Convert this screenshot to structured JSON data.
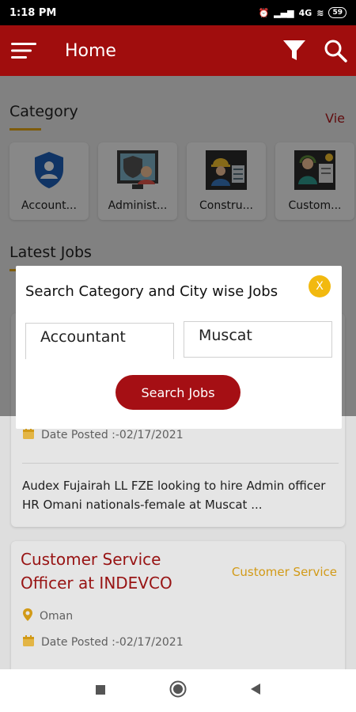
{
  "status_bar": {
    "time": "1:18 PM",
    "network": "4G",
    "battery": "59"
  },
  "app_bar": {
    "title": "Home",
    "icons": [
      "menu-icon",
      "filter-icon",
      "search-icon"
    ]
  },
  "category_section": {
    "heading": "Category",
    "view_all": "Vie",
    "categories": [
      {
        "label": "Account...",
        "icon": "shield-person-icon"
      },
      {
        "label": "Administ...",
        "icon": "admin-icon"
      },
      {
        "label": "Constru...",
        "icon": "construction-worker-icon"
      },
      {
        "label": "Custom...",
        "icon": "customer-service-icon"
      }
    ]
  },
  "latest_jobs": {
    "heading": "Latest Jobs",
    "jobs": [
      {
        "date_posted": "Date Posted :-02/17/2021",
        "description": "Audex Fujairah LL FZE looking to hire Admin officer HR Omani nationals-female at Muscat ..."
      },
      {
        "title": "Customer Service Officer at INDEVCO",
        "category": "Customer Service",
        "location": "Oman",
        "date_posted": "Date Posted :-02/17/2021"
      }
    ]
  },
  "dialog": {
    "title": "Search Category and City wise Jobs",
    "close_label": "X",
    "category_value": "Accountant",
    "city_value": "Muscat",
    "search_button": "Search Jobs"
  },
  "colors": {
    "primary": "#a00d0d",
    "accent": "#e6a817",
    "button": "#a50f14"
  }
}
